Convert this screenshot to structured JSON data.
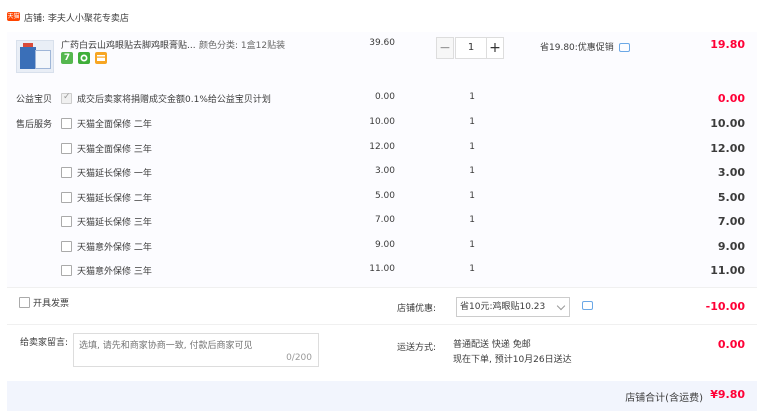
{
  "store": {
    "tag": "天猫",
    "label": "店铺:",
    "name": "李夫人小聚花专卖店"
  },
  "product": {
    "name": "广药白云山鸡眼贴去脚鸡眼膏贴...",
    "spec_label": "颜色分类:",
    "spec_value": "1盒12贴装",
    "unit_price": "39.60",
    "quantity": "1",
    "minus": "−",
    "plus": "+",
    "promo": "省19.80:优惠促销",
    "subtotal": "19.80",
    "badge_icons": [
      "seven-day-return-icon",
      "guarantee-icon",
      "card-icon"
    ],
    "badge_text": [
      "7",
      "",
      ""
    ]
  },
  "charity": {
    "label": "公益宝贝",
    "text": "成交后卖家将捐赠成交金额0.1%给公益宝贝计划",
    "price": "0.00",
    "qty": "1",
    "subtotal": "0.00",
    "checked": true
  },
  "services_label": "售后服务",
  "services": [
    {
      "name": "天猫全面保修 二年",
      "price": "10.00",
      "qty": "1",
      "subtotal": "10.00"
    },
    {
      "name": "天猫全面保修 三年",
      "price": "12.00",
      "qty": "1",
      "subtotal": "12.00"
    },
    {
      "name": "天猫延长保修 一年",
      "price": "3.00",
      "qty": "1",
      "subtotal": "3.00"
    },
    {
      "name": "天猫延长保修 二年",
      "price": "5.00",
      "qty": "1",
      "subtotal": "5.00"
    },
    {
      "name": "天猫延长保修 三年",
      "price": "7.00",
      "qty": "1",
      "subtotal": "7.00"
    },
    {
      "name": "天猫意外保修 二年",
      "price": "9.00",
      "qty": "1",
      "subtotal": "9.00"
    },
    {
      "name": "天猫意外保修 三年",
      "price": "11.00",
      "qty": "1",
      "subtotal": "11.00"
    }
  ],
  "invoice": {
    "label": "开具发票"
  },
  "discount": {
    "label": "店铺优惠:",
    "selected": "省10元:鸡眼贴10.23",
    "amount": "-10.00"
  },
  "message": {
    "label": "给卖家留言:",
    "placeholder": "选填, 请先和商家协商一致, 付款后商家可见",
    "count": "0/200"
  },
  "shipping": {
    "label": "运送方式:",
    "method": "普通配送 快递 免邮",
    "eta": "现在下单, 预计10月26日送达",
    "fee": "0.00"
  },
  "total": {
    "label": "店铺合计(含运费)",
    "value": "¥9.80"
  },
  "colors": {
    "accent": "#ff0036",
    "footer_bg": "#f2f5fd",
    "store_tag": "#ff4400"
  }
}
